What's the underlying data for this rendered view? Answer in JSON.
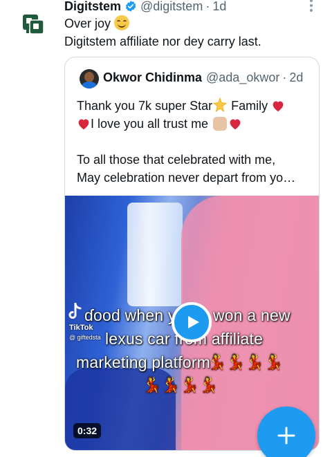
{
  "tweet": {
    "display_name": "Digitstem",
    "handle": "@digitstem",
    "separator": "·",
    "time": "1d",
    "line1": "Over joy",
    "line2": "Digitstem affiliate nor dey carry last."
  },
  "quoted": {
    "display_name": "Okwor Chidinma",
    "handle": "@ada_okwor",
    "separator": "·",
    "time": "2d",
    "line1_a": "Thank you 7k super  Star",
    "line1_b": " Family ",
    "line2": "I love you all trust me ",
    "line3": "To all those that celebrated with me,",
    "line4": "May celebration never depart from yo…"
  },
  "video": {
    "caption_line1": "ɗood when yo",
    "caption_line1_b": "won a new",
    "caption_line2": "lexus car from affiliate",
    "caption_line3": "marketing platform",
    "tiktok_brand": "TikTok",
    "tiktok_user": "@ giftedsta",
    "duration": "0:32"
  },
  "icons": {
    "avatar": "digitstem-logo-icon",
    "verified": "verified-badge-icon",
    "more": "more-options-icon",
    "play": "play-icon",
    "compose": "plus-icon"
  },
  "colors": {
    "accent": "#1d9bf0",
    "secondary_text": "#536471",
    "logo_green": "#1f5b3a",
    "heart": "#d7263d"
  }
}
